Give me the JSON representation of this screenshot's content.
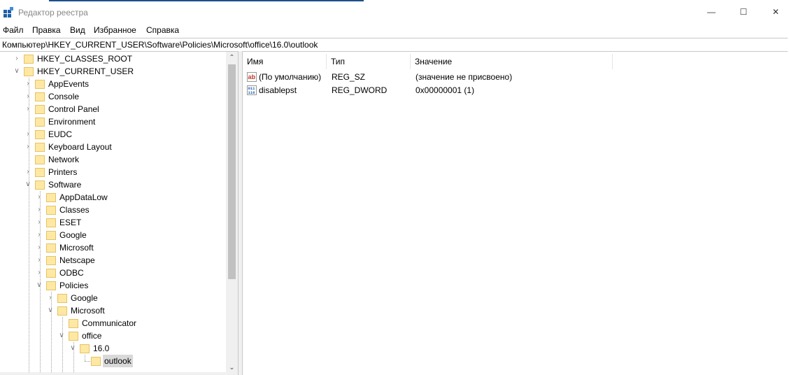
{
  "window": {
    "title": "Редактор реестра",
    "minimize_glyph": "—",
    "maximize_glyph": "☐",
    "close_glyph": "✕"
  },
  "menu": [
    "Файл",
    "Правка",
    "Вид",
    "Избранное",
    "Справка"
  ],
  "address": "Компьютер\\HKEY_CURRENT_USER\\Software\\Policies\\Microsoft\\office\\16.0\\outlook",
  "tree": [
    {
      "label": "HKEY_CLASSES_ROOT",
      "expander": "collapsed"
    },
    {
      "label": "HKEY_CURRENT_USER",
      "expander": "expanded"
    },
    {
      "label": "AppEvents",
      "expander": "collapsed"
    },
    {
      "label": "Console",
      "expander": "collapsed"
    },
    {
      "label": "Control Panel",
      "expander": "collapsed"
    },
    {
      "label": "Environment",
      "expander": "none"
    },
    {
      "label": "EUDC",
      "expander": "collapsed"
    },
    {
      "label": "Keyboard Layout",
      "expander": "collapsed"
    },
    {
      "label": "Network",
      "expander": "none"
    },
    {
      "label": "Printers",
      "expander": "collapsed"
    },
    {
      "label": "Software",
      "expander": "expanded"
    },
    {
      "label": "AppDataLow",
      "expander": "collapsed"
    },
    {
      "label": "Classes",
      "expander": "collapsed"
    },
    {
      "label": "ESET",
      "expander": "collapsed"
    },
    {
      "label": "Google",
      "expander": "collapsed"
    },
    {
      "label": "Microsoft",
      "expander": "collapsed"
    },
    {
      "label": "Netscape",
      "expander": "collapsed"
    },
    {
      "label": "ODBC",
      "expander": "collapsed"
    },
    {
      "label": "Policies",
      "expander": "expanded"
    },
    {
      "label": "Google",
      "expander": "collapsed"
    },
    {
      "label": "Microsoft",
      "expander": "expanded"
    },
    {
      "label": "Communicator",
      "expander": "none"
    },
    {
      "label": "office",
      "expander": "expanded"
    },
    {
      "label": "16.0",
      "expander": "expanded"
    },
    {
      "label": "outlook",
      "expander": "none",
      "selected": true
    }
  ],
  "list": {
    "headers": [
      "Имя",
      "Тип",
      "Значение"
    ],
    "rows": [
      {
        "icon": "string-value-icon",
        "icon_text": "ab",
        "name": "(По умолчанию)",
        "type": "REG_SZ",
        "value": "(значение не присвоено)"
      },
      {
        "icon": "binary-value-icon",
        "icon_text": "011\n110",
        "name": "disablepst",
        "type": "REG_DWORD",
        "value": "0x00000001 (1)"
      }
    ]
  },
  "colors": {
    "folder_fill": "#ffe8a3",
    "folder_border": "#e5c365",
    "selection": "#d9d9d9",
    "icon_red": "#c0392b",
    "icon_blue": "#1f5fa8"
  }
}
